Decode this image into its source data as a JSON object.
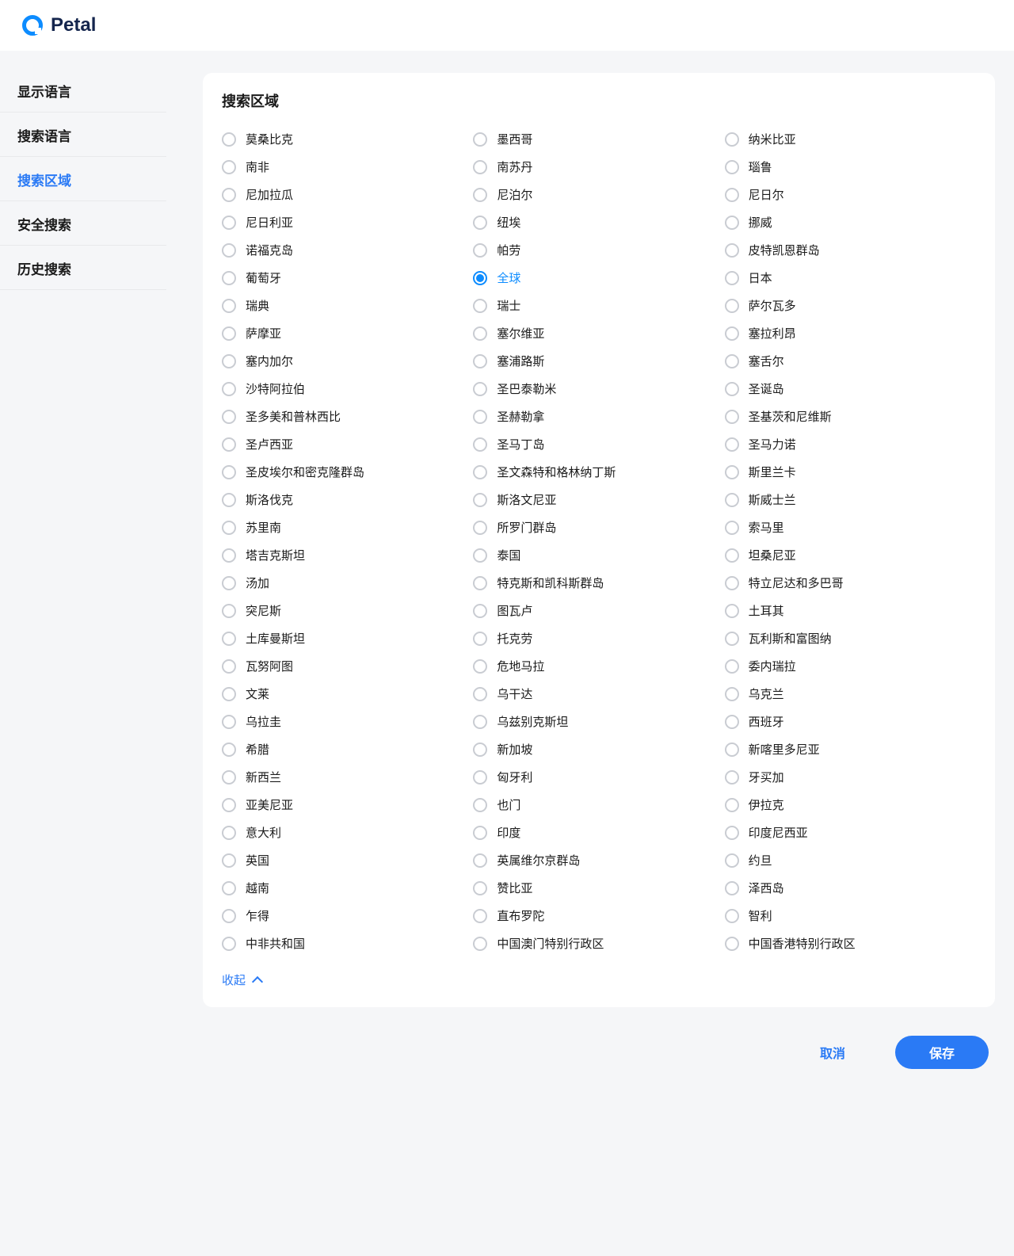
{
  "brand": "Petal",
  "sidebar": {
    "items": [
      {
        "id": "display-language",
        "label": "显示语言",
        "active": false
      },
      {
        "id": "search-language",
        "label": "搜索语言",
        "active": false
      },
      {
        "id": "search-region",
        "label": "搜索区域",
        "active": true
      },
      {
        "id": "safe-search",
        "label": "安全搜索",
        "active": false
      },
      {
        "id": "history-search",
        "label": "历史搜索",
        "active": false
      }
    ]
  },
  "section": {
    "title": "搜索区域",
    "collapse_label": "收起",
    "selected": "全球",
    "regions": [
      "莫桑比克",
      "墨西哥",
      "纳米比亚",
      "南非",
      "南苏丹",
      "瑙鲁",
      "尼加拉瓜",
      "尼泊尔",
      "尼日尔",
      "尼日利亚",
      "纽埃",
      "挪威",
      "诺福克岛",
      "帕劳",
      "皮特凯恩群岛",
      "葡萄牙",
      "全球",
      "日本",
      "瑞典",
      "瑞士",
      "萨尔瓦多",
      "萨摩亚",
      "塞尔维亚",
      "塞拉利昂",
      "塞内加尔",
      "塞浦路斯",
      "塞舌尔",
      "沙特阿拉伯",
      "圣巴泰勒米",
      "圣诞岛",
      "圣多美和普林西比",
      "圣赫勒拿",
      "圣基茨和尼维斯",
      "圣卢西亚",
      "圣马丁岛",
      "圣马力诺",
      "圣皮埃尔和密克隆群岛",
      "圣文森特和格林纳丁斯",
      "斯里兰卡",
      "斯洛伐克",
      "斯洛文尼亚",
      "斯威士兰",
      "苏里南",
      "所罗门群岛",
      "索马里",
      "塔吉克斯坦",
      "泰国",
      "坦桑尼亚",
      "汤加",
      "特克斯和凯科斯群岛",
      "特立尼达和多巴哥",
      "突尼斯",
      "图瓦卢",
      "土耳其",
      "土库曼斯坦",
      "托克劳",
      "瓦利斯和富图纳",
      "瓦努阿图",
      "危地马拉",
      "委内瑞拉",
      "文莱",
      "乌干达",
      "乌克兰",
      "乌拉圭",
      "乌兹别克斯坦",
      "西班牙",
      "希腊",
      "新加坡",
      "新喀里多尼亚",
      "新西兰",
      "匈牙利",
      "牙买加",
      "亚美尼亚",
      "也门",
      "伊拉克",
      "意大利",
      "印度",
      "印度尼西亚",
      "英国",
      "英属维尔京群岛",
      "约旦",
      "越南",
      "赞比亚",
      "泽西岛",
      "乍得",
      "直布罗陀",
      "智利",
      "中非共和国",
      "中国澳门特别行政区",
      "中国香港特别行政区"
    ]
  },
  "actions": {
    "cancel": "取消",
    "save": "保存"
  }
}
